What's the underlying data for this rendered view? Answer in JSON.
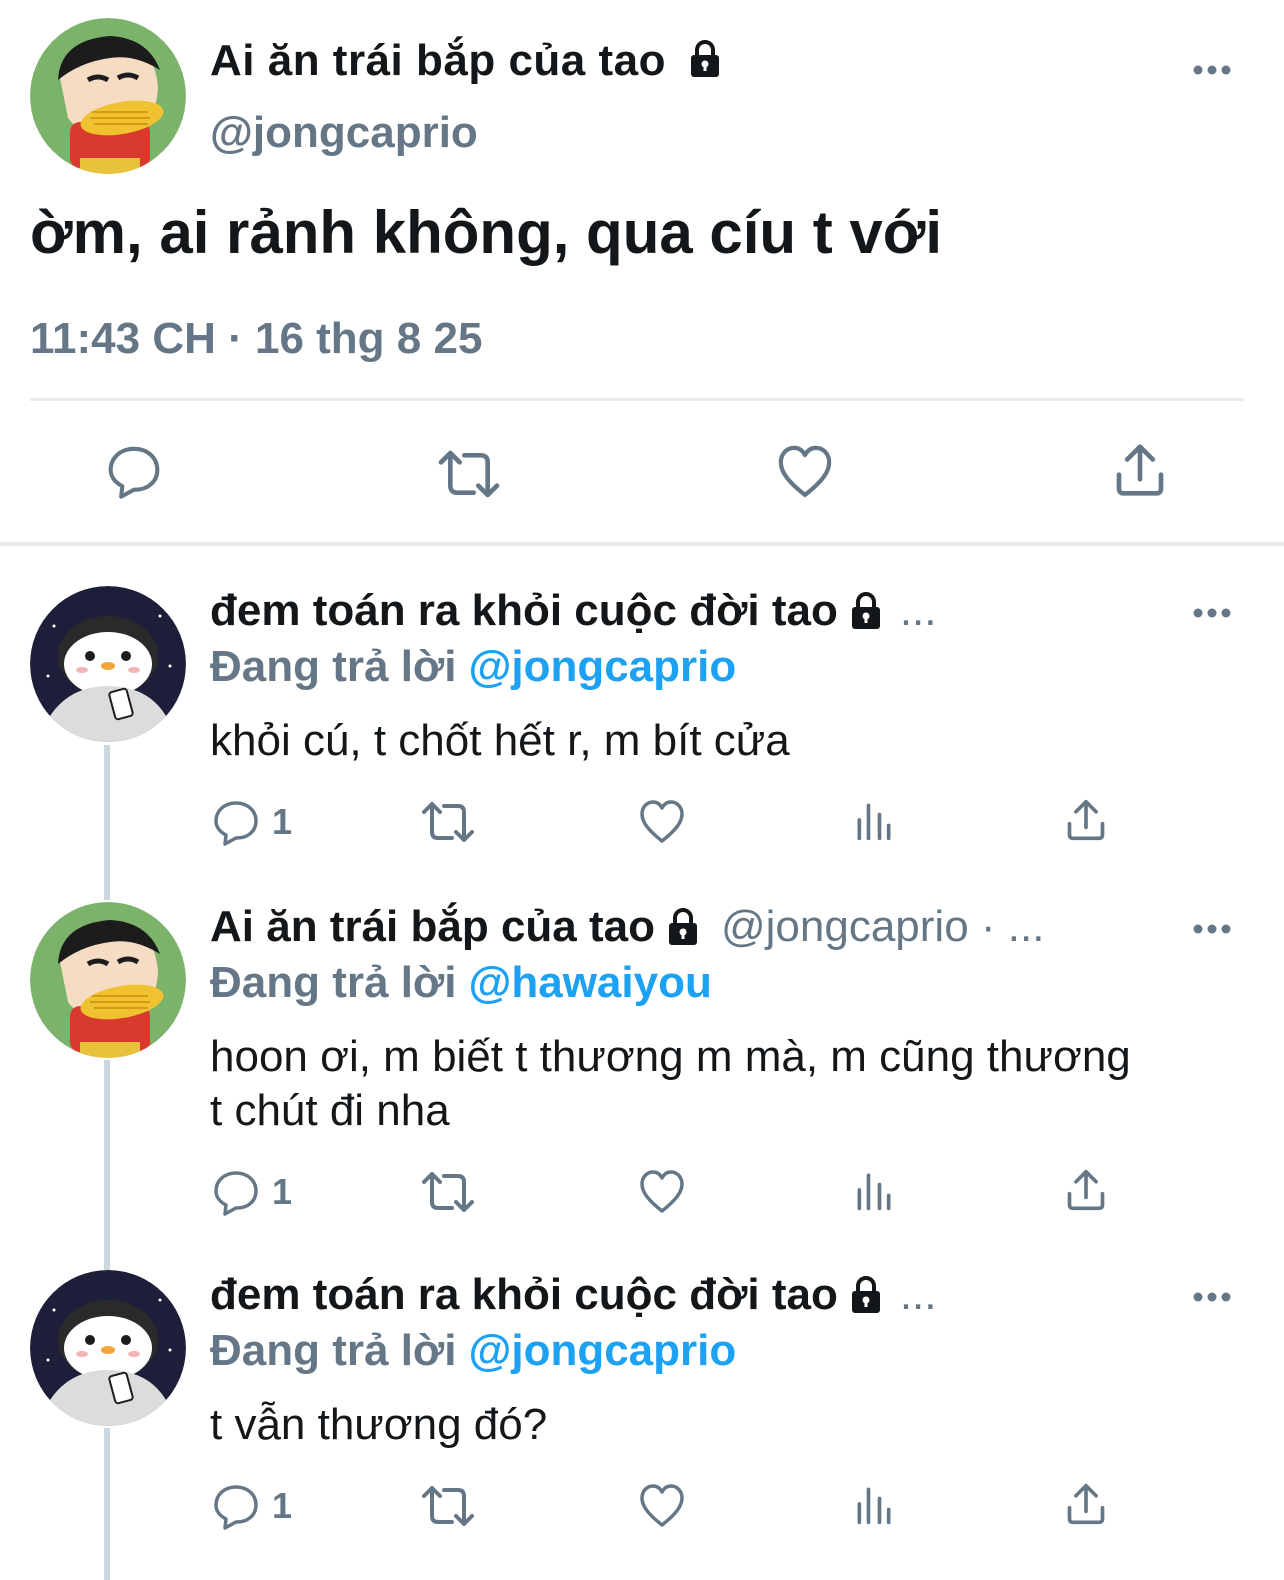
{
  "main_tweet": {
    "display_name": "Ai ăn trái bắp của tao",
    "handle": "@jongcaprio",
    "text": "ờm, ai rảnh không, qua cíu t với",
    "timestamp": "11:43 CH · 16 thg 8 25",
    "actions": [
      "reply-icon",
      "retweet-icon",
      "like-icon",
      "share-icon"
    ]
  },
  "replies": [
    {
      "display_name": "đem toán ra khỏi cuộc đời tao",
      "handle": "",
      "ellipsis": "...",
      "replying_label": "Đang trả lời",
      "replying_to": "@jongcaprio",
      "text": "khỏi cú, t chốt hết r, m bít cửa",
      "reply_count": "1"
    },
    {
      "display_name": "Ai ăn trái bắp của tao",
      "handle": "@jongcaprio · ...",
      "ellipsis": "",
      "replying_label": "Đang trả lời",
      "replying_to": "@hawaiyou",
      "text": "hoon ơi, m biết t thương m mà, m cũng thương t chút đi nha",
      "reply_count": "1"
    },
    {
      "display_name": "đem toán ra khỏi cuộc đời tao",
      "handle": "",
      "ellipsis": "...",
      "replying_label": "Đang trả lời",
      "replying_to": "@jongcaprio",
      "text": "t vẫn thương đó?",
      "reply_count": "1"
    }
  ],
  "colors": {
    "text": "#14171a",
    "secondary": "#657786",
    "accent": "#1da1f2",
    "divider": "#e6ecf0"
  }
}
